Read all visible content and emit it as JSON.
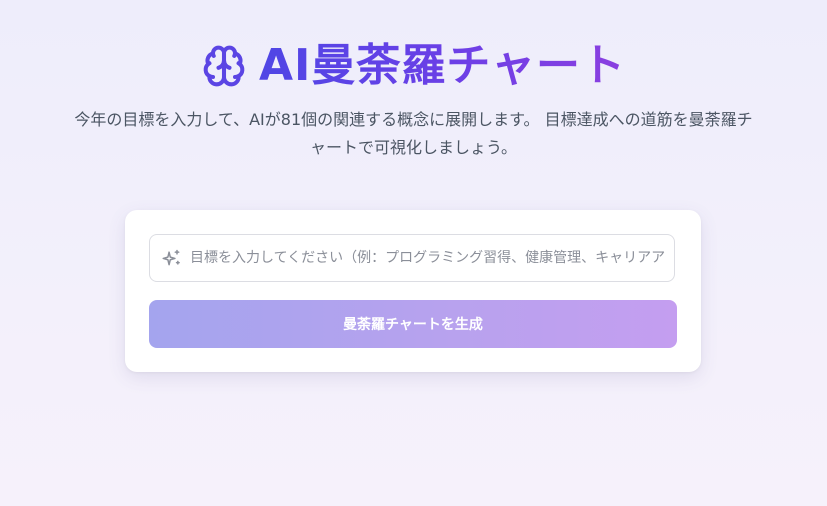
{
  "header": {
    "icon": "brain-icon",
    "title": "AI曼荼羅チャート",
    "description": "今年の目標を入力して、AIが81個の関連する概念に展開します。 目標達成への道筋を曼荼羅チャートで可視化しましょう。"
  },
  "form": {
    "input_icon": "sparkle-icon",
    "goal_value": "",
    "goal_placeholder": "目標を入力してください（例：プログラミング習得、健康管理、キャリアアップ）",
    "submit_label": "曼荼羅チャートを生成"
  },
  "colors": {
    "title_gradient_start": "#4f46e5",
    "title_gradient_end": "#8b3fe0",
    "button_gradient_start": "#a4a4ee",
    "button_gradient_end": "#c49ef0",
    "background": "#eeedfb"
  }
}
